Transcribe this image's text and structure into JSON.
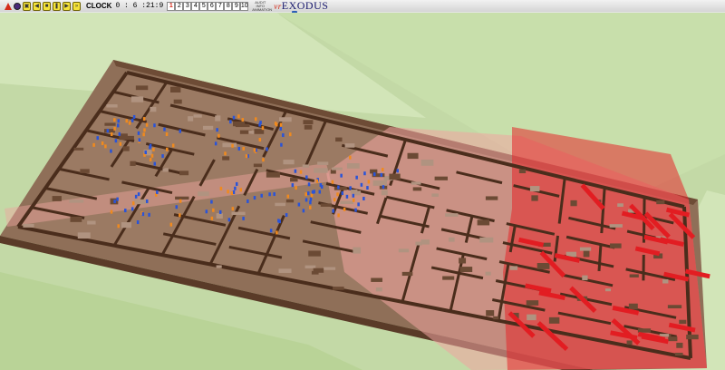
{
  "app": {
    "name_prefix": "vr",
    "name": "EXODUS"
  },
  "toolbar": {
    "clock_label": "CLOCK",
    "clock_value": "0 : 6 :21:9",
    "floors": [
      "1",
      "2",
      "3",
      "4",
      "5",
      "6",
      "7",
      "8",
      "9",
      "10"
    ],
    "active_floor": "1",
    "small_caption": "AUDIT INFO ANIMATION"
  },
  "colors": {
    "background": "#c3d9a6",
    "floor": "#9b7a63",
    "wall": "#5a3b28",
    "smoke": "#e6262a",
    "occupant_blue": "#2a54d8",
    "occupant_orange": "#f08a1e"
  }
}
